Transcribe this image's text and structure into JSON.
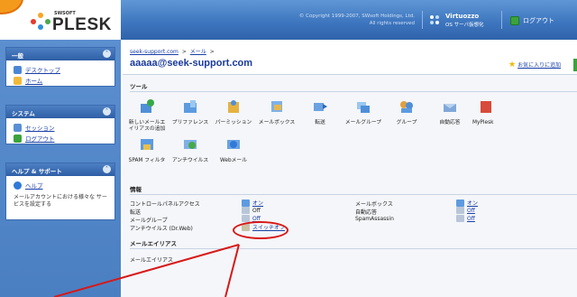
{
  "header": {
    "brand_small": "SWSOFT",
    "brand": "PLESK",
    "copyright_line1": "© Copyright 1999-2007, SWsoft Holdings, Ltd.",
    "copyright_line2": "All rights reserved",
    "virtuozzo_title": "Virtuozzo",
    "virtuozzo_sub": "OS サーバ仮想化",
    "logout_label": "ログアウト"
  },
  "sidebar": {
    "panels": [
      {
        "title": "一般",
        "items": [
          {
            "label": "デスクトップ"
          },
          {
            "label": "ホーム"
          }
        ]
      },
      {
        "title": "システム",
        "items": [
          {
            "label": "セッション"
          },
          {
            "label": "ログアウト"
          }
        ]
      },
      {
        "title": "ヘルプ & サポート",
        "items": [
          {
            "label": "ヘルプ"
          }
        ],
        "description": "メールアカウントにおける様々な サービスを設定する"
      }
    ]
  },
  "main": {
    "breadcrumb": [
      "seek-support.com",
      "メール"
    ],
    "breadcrumb_sep": ">",
    "title": "aaaaa@seek-support.com",
    "favorite_label": "お気に入りに追加",
    "tools_title": "ツール",
    "tools": [
      {
        "label": "新しいメールエイリアスの追加",
        "icon": "add-alias-icon"
      },
      {
        "label": "プリファレンス",
        "icon": "preferences-icon"
      },
      {
        "label": "パーミッション",
        "icon": "permissions-icon"
      },
      {
        "label": "メールボックス",
        "icon": "mailbox-icon"
      },
      {
        "label": "転送",
        "icon": "forwarding-icon"
      },
      {
        "label": "メールグループ",
        "icon": "mail-group-icon"
      },
      {
        "label": "グループ",
        "icon": "group-icon"
      },
      {
        "label": "自動応答",
        "icon": "autoresponder-icon"
      },
      {
        "label": "MyPlesk",
        "icon": "myplesk-icon"
      },
      {
        "label": "SPAM フィルタ",
        "icon": "spam-filter-icon"
      },
      {
        "label": "アンチウイルス",
        "icon": "antivirus-icon"
      },
      {
        "label": "Webメール",
        "icon": "webmail-icon"
      }
    ],
    "info_title": "情報",
    "info_left": [
      {
        "label": "コントロールパネルアクセス",
        "value": "オン"
      },
      {
        "label": "転送",
        "value": "Off"
      },
      {
        "label": "メールグループ",
        "value": "Off"
      },
      {
        "label": "アンチウイルス (Dr.Web)",
        "value": "スイッチオフ"
      }
    ],
    "info_right": [
      {
        "label": "メールボックス",
        "value": "オン"
      },
      {
        "label": "自動応答",
        "value": "Off"
      },
      {
        "label": "SpamAssassin",
        "value": "Off"
      }
    ],
    "aliases_title": "メールエイリアス",
    "aliases_cut_label": "メールエイリアス"
  },
  "colors": {
    "header_blue": "#3c74bd",
    "link_blue": "#1a3fa8",
    "highlight_red": "#d81818",
    "orange_accent": "#f39a1d"
  }
}
